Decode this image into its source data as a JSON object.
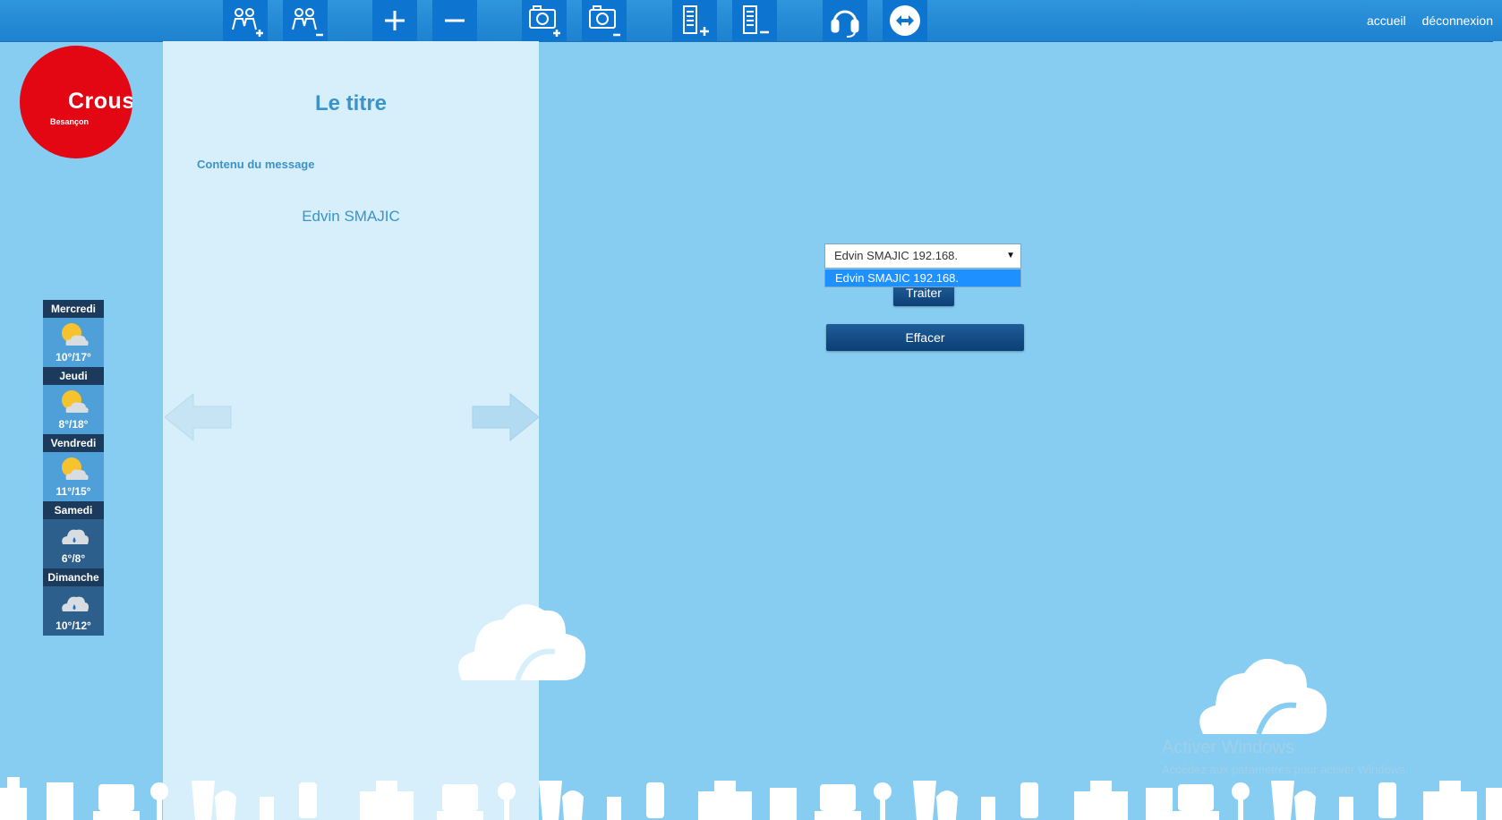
{
  "toolbar": {
    "buttons": [
      {
        "name": "add-group-button",
        "icon": "group-plus-icon"
      },
      {
        "name": "remove-group-button",
        "icon": "group-minus-icon"
      },
      {
        "name": "add-button",
        "icon": "plus-icon"
      },
      {
        "name": "remove-button",
        "icon": "minus-icon"
      },
      {
        "name": "add-camera-button",
        "icon": "camera-plus-icon"
      },
      {
        "name": "remove-camera-button",
        "icon": "camera-minus-icon"
      },
      {
        "name": "add-list-button",
        "icon": "list-plus-icon"
      },
      {
        "name": "remove-list-button",
        "icon": "list-minus-icon"
      },
      {
        "name": "support-button",
        "icon": "headset-icon"
      },
      {
        "name": "transfer-button",
        "icon": "double-arrow-icon"
      }
    ],
    "links": {
      "home": "accueil",
      "logout": "déconnexion"
    },
    "colors": {
      "bar": "#2f95dc",
      "button": "#0d74cf"
    }
  },
  "logo": {
    "brand": "Crous",
    "city": "Besançon",
    "color": "#e30613"
  },
  "message": {
    "title": "Le titre",
    "content_label": "Contenu du message",
    "author": "Edvin SMAJIC"
  },
  "weather": [
    {
      "day": "Mercredi",
      "temp": "10°/17°",
      "icon": "sun-cloud-icon"
    },
    {
      "day": "Jeudi",
      "temp": "8°/18°",
      "icon": "sun-cloud-icon"
    },
    {
      "day": "Vendredi",
      "temp": "11°/15°",
      "icon": "sun-cloud-icon"
    },
    {
      "day": "Samedi",
      "temp": "6°/8°",
      "icon": "rain-cloud-icon"
    },
    {
      "day": "Dimanche",
      "temp": "10°/12°",
      "icon": "rain-cloud-icon"
    }
  ],
  "form": {
    "select_value": "Edvin SMAJIC 192.168.",
    "select_option": "Edvin SMAJIC 192.168.",
    "process_label": "Traiter",
    "clear_label": "Effacer"
  },
  "system_watermark": {
    "line1": "Activer Windows",
    "line2": "Accédez aux paramètres pour activer Windows."
  }
}
